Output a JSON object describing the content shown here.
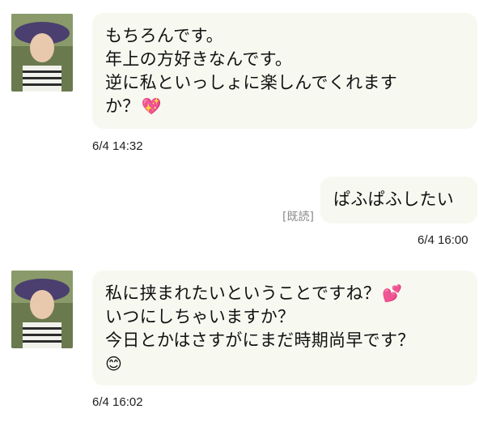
{
  "colors": {
    "background": "#ffffff",
    "bubble": "#f7f8f0",
    "text": "#111111",
    "read_receipt": "#8a8a8a"
  },
  "messages": [
    {
      "sender": "other",
      "avatar_icon": "user-avatar-photo",
      "lines": [
        "もちろんです。",
        "年上の方好きなんです。",
        "逆に私といっしょに楽しんでくれます",
        "か？"
      ],
      "emoji": "💖",
      "time": "6/4 14:32"
    },
    {
      "sender": "self",
      "lines": [
        "ぱふぱふしたい"
      ],
      "read_label": "[既読]",
      "time": "6/4 16:00"
    },
    {
      "sender": "other",
      "avatar_icon": "user-avatar-photo",
      "lines": [
        "私に挟まれたいということですね？",
        "いつにしちゃいますか？",
        "今日とかはさすがにまだ時期尚早です？"
      ],
      "emoji_line1": "💕",
      "emoji_last": "😊",
      "time": "6/4 16:02"
    }
  ]
}
